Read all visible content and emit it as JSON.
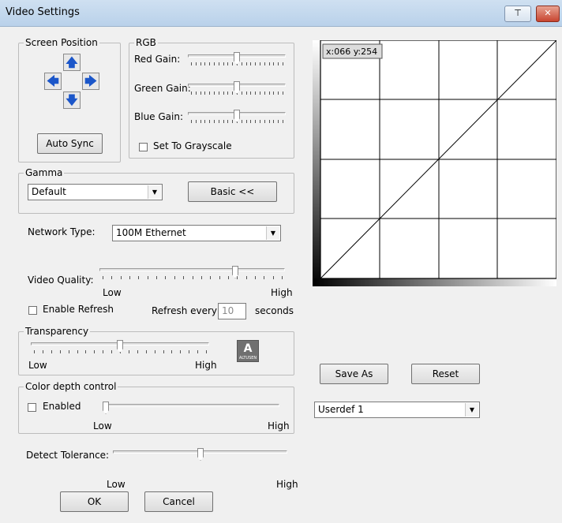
{
  "window": {
    "title": "Video Settings",
    "pin_glyph": "⊤",
    "close_glyph": "✕"
  },
  "screen_position": {
    "label": "Screen Position",
    "auto_sync": "Auto Sync",
    "icons": [
      "up-arrow-icon",
      "left-arrow-icon",
      "right-arrow-icon",
      "down-arrow-icon"
    ]
  },
  "rgb": {
    "label": "RGB",
    "red": "Red Gain:",
    "green": "Green Gain:",
    "blue": "Blue Gain:",
    "grayscale": "Set To Grayscale",
    "levels": {
      "red": 0.5,
      "green": 0.5,
      "blue": 0.5
    }
  },
  "gamma": {
    "label": "Gamma",
    "value": "Default",
    "basic_button": "Basic <<"
  },
  "network": {
    "label": "Network Type:",
    "value": "100M Ethernet"
  },
  "video_quality": {
    "label": "Video Quality:",
    "low": "Low",
    "high": "High",
    "level": 0.74
  },
  "refresh": {
    "enable_label": "Enable Refresh",
    "every_label": "Refresh every",
    "value": "10",
    "unit": "seconds"
  },
  "transparency": {
    "label": "Transparency",
    "low": "Low",
    "high": "High",
    "level": 0.5
  },
  "color_depth": {
    "label": "Color depth control",
    "enabled_label": "Enabled",
    "low": "Low",
    "high": "High",
    "level": 0.0
  },
  "detect_tolerance": {
    "label": "Detect Tolerance:",
    "low": "Low",
    "high": "High",
    "level": 0.5
  },
  "buttons": {
    "ok": "OK",
    "cancel": "Cancel",
    "save_as": "Save As",
    "reset": "Reset"
  },
  "preset": {
    "value": "Userdef 1"
  },
  "gamma_curve": {
    "readout": "x:066 y:254"
  },
  "colors": {
    "grid": "#000000",
    "title_bar": "#b9d1ea",
    "arrow": "#1b56c9"
  }
}
